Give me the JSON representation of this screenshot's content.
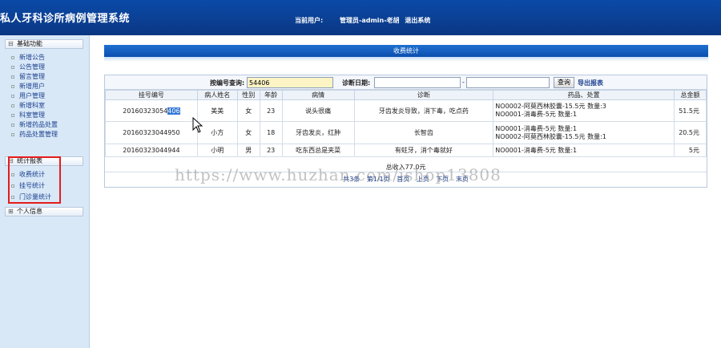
{
  "header": {
    "title": "私人牙科诊所病例管理系统",
    "current_user_label": "当前用户:",
    "user": "管理员-admin-老胡",
    "logout": "退出系统"
  },
  "sidebar": {
    "groups": [
      {
        "label": "基础功能",
        "items": [
          "新增公告",
          "公告管理",
          "留言管理",
          "新增用户",
          "用户管理",
          "新增科室",
          "科室管理",
          "新增药品处置",
          "药品处置管理"
        ]
      },
      {
        "label": "统计报表",
        "items": [
          "收费统计",
          "挂号统计",
          "门诊量统计"
        ]
      },
      {
        "label": "个人信息",
        "items": []
      }
    ]
  },
  "panel": {
    "title": "收费统计"
  },
  "search": {
    "reg_label": "按编号查询:",
    "reg_value": "54406",
    "date_label": "诊断日期:",
    "date_from": "",
    "date_sep": "-",
    "date_to": "",
    "query_button": "查询",
    "export_link": "导出报表"
  },
  "table": {
    "columns": [
      "挂号编号",
      "病人姓名",
      "性别",
      "年龄",
      "病情",
      "诊断",
      "药品、处置",
      "总金额"
    ],
    "rows": [
      {
        "id_prefix": "20160323054",
        "id_selected": "406",
        "name": "美美",
        "gender": "女",
        "age": "23",
        "condition": "说头很痛",
        "diagnosis": "牙齿发炎导致，消下毒，吃点药",
        "meds": [
          "NO0002-阿莫西林胶囊-15.5元  数量:3",
          "NO0001-消毒费-5元  数量:1"
        ],
        "total": "51.5元"
      },
      {
        "id_prefix": "20160323044950",
        "id_selected": "",
        "name": "小方",
        "gender": "女",
        "age": "18",
        "condition": "牙齿发炎，红肿",
        "diagnosis": "长智齿",
        "meds": [
          "NO0001-消毒费-5元  数量:1",
          "NO0002-阿莫西林胶囊-15.5元  数量:1"
        ],
        "total": "20.5元"
      },
      {
        "id_prefix": "20160323044944",
        "id_selected": "",
        "name": "小明",
        "gender": "男",
        "age": "23",
        "condition": "吃东西总是夹菜",
        "diagnosis": "有蛀牙，消个毒就好",
        "meds": [
          "NO0001-消毒费-5元  数量:1"
        ],
        "total": "5元"
      }
    ],
    "summary": "总收入77.0元"
  },
  "pager": [
    "共3条",
    "第1/1页",
    "首页",
    "上页",
    "下页",
    "末页"
  ],
  "watermark": "https://www.huzhan.com/ishop13808"
}
